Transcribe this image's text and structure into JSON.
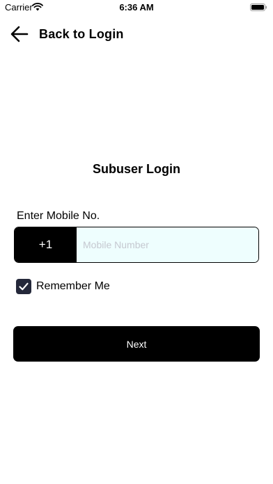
{
  "status_bar": {
    "carrier": "Carrier",
    "time": "6:36 AM",
    "wifi_icon": "wifi-icon",
    "battery_icon": "battery-icon"
  },
  "header": {
    "back_label": "Back to Login",
    "back_icon": "back-arrow-icon"
  },
  "title": "Subuser Login",
  "form": {
    "mobile_label": "Enter Mobile No.",
    "country_code": "+1",
    "mobile_value": "",
    "mobile_placeholder": "Mobile Number",
    "remember_label": "Remember Me",
    "remember_checked": true,
    "next_label": "Next"
  },
  "colors": {
    "primary": "#000000",
    "input_background": "#eefefe",
    "checkbox": "#24283a",
    "placeholder": "#c5c8d0"
  }
}
